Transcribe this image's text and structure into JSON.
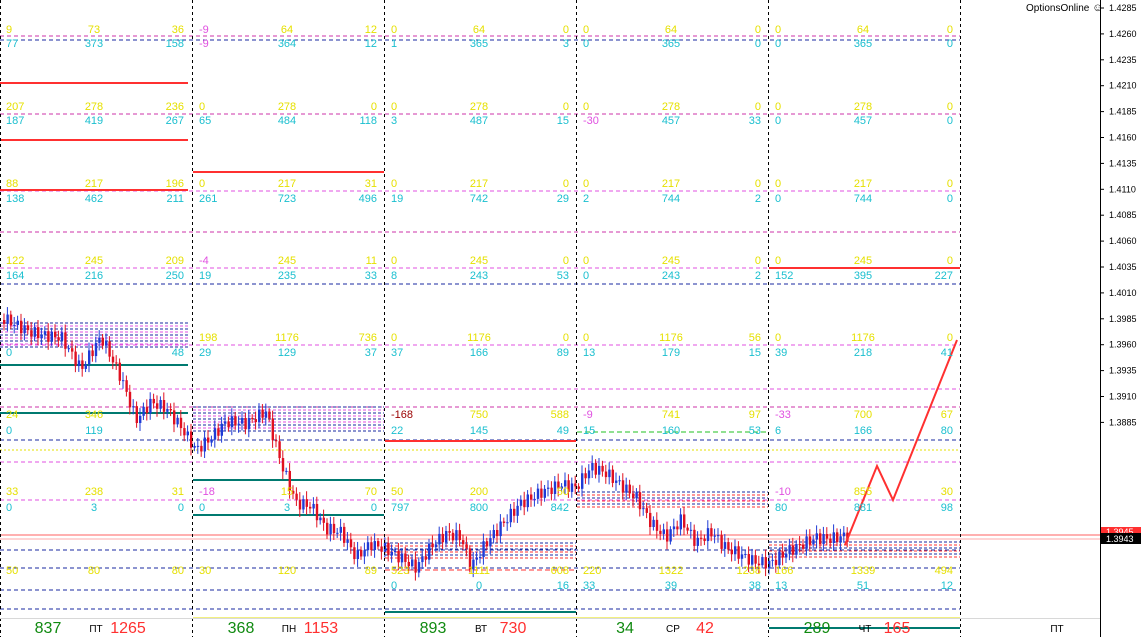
{
  "brand": {
    "name": "OptionsOnline",
    "icon": "smiley-icon"
  },
  "colors": {
    "bull": "#1f3bd6",
    "bear": "#e01020",
    "cyan": "#1abfcf",
    "yellow": "#e6e000",
    "magenta": "#e050e0",
    "teal": "#007a70",
    "red": "#ff3030",
    "green": "#108a10",
    "navy": "#1a2aa0",
    "darkred": "#9a0000"
  },
  "price_axis": {
    "ticks": [
      "1.4285",
      "1.4260",
      "1.4235",
      "1.4210",
      "1.4185",
      "1.4160",
      "1.4135",
      "1.4110",
      "1.4085",
      "1.4060",
      "1.4035",
      "1.4010",
      "1.3985",
      "1.3960",
      "1.3935",
      "1.3910",
      "1.3885"
    ],
    "bid": "1.3945",
    "current": "1.3943"
  },
  "day_footer": [
    {
      "left": "837",
      "day": "ПТ",
      "right": "1265"
    },
    {
      "left": "368",
      "day": "ПН",
      "right": "1153"
    },
    {
      "left": "893",
      "day": "ВТ",
      "right": "730"
    },
    {
      "left": "34",
      "day": "СР",
      "right": "42"
    },
    {
      "left": "289",
      "day": "ЧТ",
      "right": "165"
    },
    {
      "left": "",
      "day": "ПТ",
      "right": ""
    }
  ],
  "zones": [
    {
      "row": 0,
      "col": 0,
      "top": [
        "9",
        "73",
        "36"
      ],
      "bottom": [
        "77",
        "373",
        "158"
      ]
    },
    {
      "row": 0,
      "col": 1,
      "top": [
        "-9",
        "64",
        "12"
      ],
      "bottom": [
        "-9",
        "364",
        "12"
      ]
    },
    {
      "row": 0,
      "col": 2,
      "top": [
        "0",
        "64",
        "0"
      ],
      "bottom": [
        "1",
        "365",
        "3"
      ]
    },
    {
      "row": 0,
      "col": 3,
      "top": [
        "0",
        "64",
        "0"
      ],
      "bottom": [
        "0",
        "365",
        "0"
      ]
    },
    {
      "row": 0,
      "col": 4,
      "top": [
        "0",
        "64",
        "0"
      ],
      "bottom": [
        "0",
        "365",
        "0"
      ]
    },
    {
      "row": 1,
      "col": 0,
      "top": [
        "207",
        "278",
        "236"
      ],
      "bottom": [
        "187",
        "419",
        "267"
      ]
    },
    {
      "row": 1,
      "col": 1,
      "top": [
        "0",
        "278",
        "0"
      ],
      "bottom": [
        "65",
        "484",
        "118"
      ]
    },
    {
      "row": 1,
      "col": 2,
      "top": [
        "0",
        "278",
        "0"
      ],
      "bottom": [
        "3",
        "487",
        "15"
      ]
    },
    {
      "row": 1,
      "col": 3,
      "top": [
        "0",
        "278",
        "0"
      ],
      "bottom": [
        "-30",
        "457",
        "33"
      ]
    },
    {
      "row": 1,
      "col": 4,
      "top": [
        "0",
        "278",
        "0"
      ],
      "bottom": [
        "0",
        "457",
        "0"
      ]
    },
    {
      "row": 2,
      "col": 0,
      "top": [
        "88",
        "217",
        "196"
      ],
      "bottom": [
        "138",
        "462",
        "211"
      ]
    },
    {
      "row": 2,
      "col": 1,
      "top": [
        "0",
        "217",
        "31"
      ],
      "bottom": [
        "261",
        "723",
        "496"
      ]
    },
    {
      "row": 2,
      "col": 2,
      "top": [
        "0",
        "217",
        "0"
      ],
      "bottom": [
        "19",
        "742",
        "29"
      ]
    },
    {
      "row": 2,
      "col": 3,
      "top": [
        "0",
        "217",
        "0"
      ],
      "bottom": [
        "2",
        "744",
        "2"
      ]
    },
    {
      "row": 2,
      "col": 4,
      "top": [
        "0",
        "217",
        "0"
      ],
      "bottom": [
        "0",
        "744",
        "0"
      ]
    },
    {
      "row": 3,
      "col": 0,
      "top": [
        "122",
        "245",
        "209"
      ],
      "bottom": [
        "164",
        "216",
        "250"
      ]
    },
    {
      "row": 3,
      "col": 1,
      "top": [
        "-4",
        "245",
        "11"
      ],
      "bottom": [
        "19",
        "235",
        "33"
      ]
    },
    {
      "row": 3,
      "col": 2,
      "top": [
        "0",
        "245",
        "0"
      ],
      "bottom": [
        "8",
        "243",
        "53"
      ]
    },
    {
      "row": 3,
      "col": 3,
      "top": [
        "0",
        "245",
        "0"
      ],
      "bottom": [
        "0",
        "243",
        "2"
      ]
    },
    {
      "row": 3,
      "col": 4,
      "top": [
        "0",
        "245",
        "0"
      ],
      "bottom": [
        "152",
        "395",
        "227"
      ]
    },
    {
      "row": 4,
      "col": 0,
      "top": [
        "",
        "",
        ""
      ],
      "bottom": [
        "0",
        "",
        "48"
      ]
    },
    {
      "row": 4,
      "col": 1,
      "top": [
        "198",
        "1176",
        "736"
      ],
      "bottom": [
        "29",
        "129",
        "37"
      ]
    },
    {
      "row": 4,
      "col": 2,
      "top": [
        "0",
        "1176",
        "0"
      ],
      "bottom": [
        "37",
        "166",
        "89"
      ]
    },
    {
      "row": 4,
      "col": 3,
      "top": [
        "0",
        "1176",
        "56"
      ],
      "bottom": [
        "13",
        "179",
        "15"
      ]
    },
    {
      "row": 4,
      "col": 4,
      "top": [
        "0",
        "1176",
        "0"
      ],
      "bottom": [
        "39",
        "218",
        "41"
      ]
    },
    {
      "row": 5,
      "col": 0,
      "top": [
        "24",
        "346",
        ""
      ],
      "bottom": [
        "0",
        "119",
        ""
      ]
    },
    {
      "row": 5,
      "col": 1,
      "top": [
        "",
        "",
        ""
      ],
      "bottom": [
        "",
        "",
        ""
      ]
    },
    {
      "row": 5,
      "col": 2,
      "top": [
        "-168",
        "750",
        "588"
      ],
      "bottom": [
        "22",
        "145",
        "49"
      ]
    },
    {
      "row": 5,
      "col": 3,
      "top": [
        "-9",
        "741",
        "97"
      ],
      "bottom": [
        "15",
        "160",
        "53"
      ]
    },
    {
      "row": 5,
      "col": 4,
      "top": [
        "-33",
        "700",
        "67"
      ],
      "bottom": [
        "6",
        "166",
        "80"
      ]
    },
    {
      "row": 6,
      "col": 0,
      "top": [
        "33",
        "238",
        "31"
      ],
      "bottom": [
        "0",
        "3",
        "0"
      ]
    },
    {
      "row": 6,
      "col": 1,
      "top": [
        "-18",
        "15",
        "70"
      ],
      "bottom": [
        "0",
        "3",
        "0"
      ]
    },
    {
      "row": 6,
      "col": 2,
      "top": [
        "50",
        "200",
        "50"
      ],
      "bottom": [
        "797",
        "800",
        "842"
      ]
    },
    {
      "row": 6,
      "col": 3,
      "top": [
        "",
        "",
        ""
      ],
      "bottom": [
        "",
        "",
        ""
      ]
    },
    {
      "row": 6,
      "col": 4,
      "top": [
        "-10",
        "855",
        "30"
      ],
      "bottom": [
        "80",
        "881",
        "98"
      ]
    },
    {
      "row": 7,
      "col": 0,
      "top": [
        "50",
        "80",
        "80"
      ],
      "bottom": [
        "",
        "",
        ""
      ]
    },
    {
      "row": 7,
      "col": 1,
      "top": [
        "30",
        "120",
        "89"
      ],
      "bottom": [
        "",
        "",
        ""
      ]
    },
    {
      "row": 7,
      "col": 2,
      "top": [
        "523",
        "1111",
        "608"
      ],
      "bottom": [
        "0",
        "0",
        "16"
      ]
    },
    {
      "row": 7,
      "col": 3,
      "top": [
        "220",
        "1322",
        "1238"
      ],
      "bottom": [
        "33",
        "39",
        "38"
      ]
    },
    {
      "row": 7,
      "col": 4,
      "top": [
        "166",
        "1339",
        "494"
      ],
      "bottom": [
        "13",
        "51",
        "12"
      ]
    }
  ]
}
